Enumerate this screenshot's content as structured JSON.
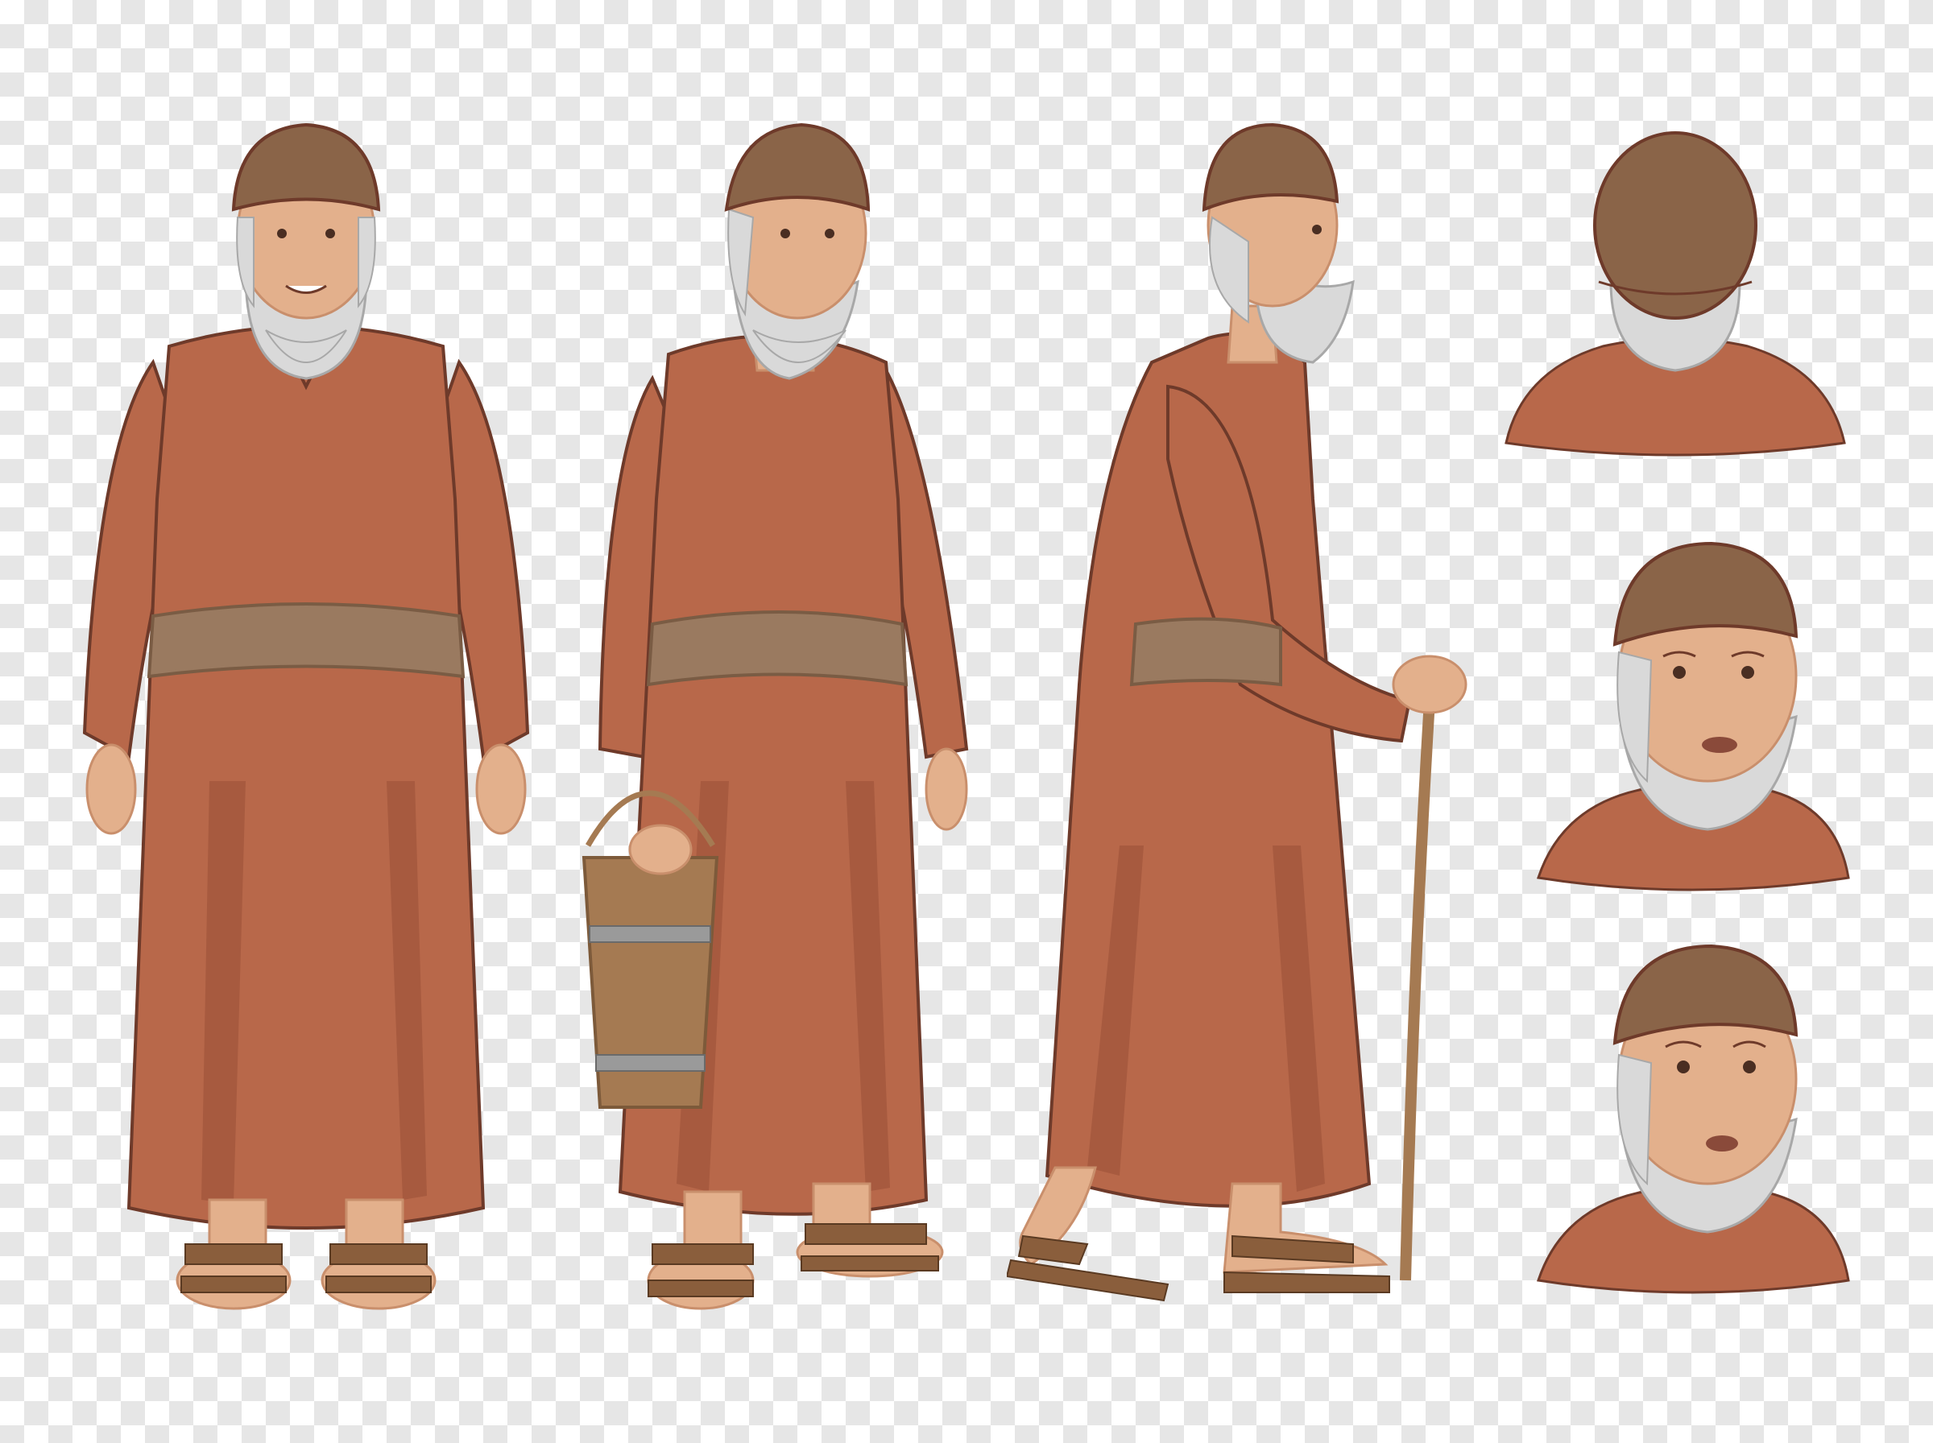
{
  "canvas": {
    "background": "transparency-checkerboard"
  },
  "palette": {
    "robe": "#b8684a",
    "robe_shadow": "#9b5238",
    "robe_outline": "#6e3a2a",
    "sash": "#9a7a60",
    "sash_dark": "#7a5c44",
    "cap": "#8a6448",
    "skin": "#e3b08c",
    "skin_shadow": "#c98f6c",
    "hair": "#d9d9d9",
    "hair_shadow": "#a8a8a8",
    "wood": "#a57a52",
    "wood_dark": "#7d5a3a",
    "metal": "#9a9a9a",
    "sandal": "#8a5e3c"
  },
  "poses": [
    {
      "id": "front",
      "icon": "figure-front"
    },
    {
      "id": "three-quarter-with-bucket",
      "icon": "figure-three-quarter"
    },
    {
      "id": "side-with-staff",
      "icon": "figure-side"
    },
    {
      "id": "head-back",
      "icon": "head-back"
    },
    {
      "id": "head-concerned",
      "icon": "head-three-quarter"
    },
    {
      "id": "head-looking-up",
      "icon": "head-three-quarter-up"
    }
  ]
}
